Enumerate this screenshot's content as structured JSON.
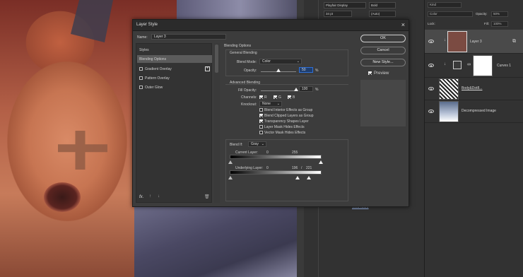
{
  "dialog": {
    "title": "Layer Style",
    "name_label": "Name:",
    "name_value": "Layer 3",
    "styles_header": "Styles",
    "styles_items": [
      {
        "label": "Blending Options",
        "selected": true
      },
      {
        "label": "Gradient Overlay",
        "checked": false,
        "has_plus": true
      },
      {
        "label": "Pattern Overlay",
        "checked": false
      },
      {
        "label": "Outer Glow",
        "checked": false
      }
    ],
    "footer_fx": "fx.",
    "buttons": {
      "ok": "OK",
      "cancel": "Cancel",
      "new_style": "New Style...",
      "preview": "Preview"
    },
    "blending": {
      "section": "Blending Options",
      "general": "General Blending",
      "blend_mode_label": "Blend Mode:",
      "blend_mode_value": "Color",
      "opacity_label": "Opacity:",
      "opacity_value": "50",
      "opacity_unit": "%",
      "advanced": "Advanced Blending",
      "fill_opacity_label": "Fill Opacity:",
      "fill_opacity_value": "100",
      "fill_unit": "%",
      "channels_label": "Channels:",
      "channels": [
        "R",
        "G",
        "B"
      ],
      "knockout_label": "Knockout:",
      "knockout_value": "None",
      "checkboxes": [
        {
          "label": "Blend Interior Effects as Group",
          "checked": false
        },
        {
          "label": "Blend Clipped Layers as Group",
          "checked": true
        },
        {
          "label": "Transparency Shapes Layer",
          "checked": true
        },
        {
          "label": "Layer Mask Hides Effects",
          "checked": false
        },
        {
          "label": "Vector Mask Hides Effects",
          "checked": false
        }
      ],
      "blend_if_label": "Blend If:",
      "blend_if_value": "Gray",
      "current_layer_label": "Current Layer:",
      "current_low": "0",
      "current_high": "255",
      "underlying_label": "Underlying Layer:",
      "underlying_low": "0",
      "underlying_mid": "196",
      "underlying_sep": "/",
      "underlying_high": "221"
    }
  },
  "properties_panel": {
    "font_value": "Playfair Display",
    "style_value": "Bold",
    "size_value": "34 pt",
    "leading_value": "(Auto)",
    "view_more": "View More"
  },
  "layers_panel": {
    "kind_label": "Kind",
    "mode_value": "Color",
    "opacity_label": "Opacity:",
    "opacity_value": "50%",
    "lock_label": "Lock:",
    "fill_label": "Fill:",
    "fill_value": "100%",
    "layers": [
      {
        "name": "Layer 3",
        "selected": true
      },
      {
        "name": "Curves 1"
      },
      {
        "name": "Body&Dot8..."
      },
      {
        "name": "Decompressed Image"
      }
    ]
  },
  "colors": {
    "accent": "#2f6fd6",
    "dialog_bg": "#3c3c3c",
    "panel_bg": "#323232"
  }
}
